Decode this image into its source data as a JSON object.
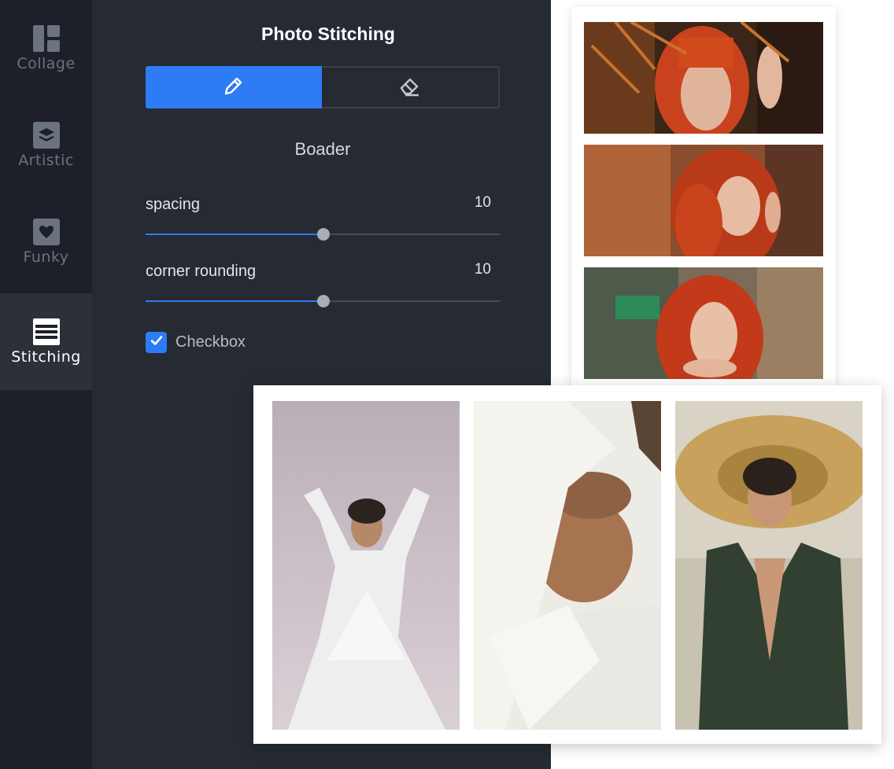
{
  "sidebar": {
    "items": [
      {
        "label": "Collage",
        "icon": "collage-icon",
        "active": false
      },
      {
        "label": "Artistic",
        "icon": "artistic-icon",
        "active": false
      },
      {
        "label": "Funky",
        "icon": "heart-icon",
        "active": false
      },
      {
        "label": "Stitching",
        "icon": "stitching-icon",
        "active": true
      }
    ]
  },
  "panel": {
    "title": "Photo Stitching",
    "segments": [
      {
        "icon": "pencil-icon",
        "active": true
      },
      {
        "icon": "eraser-icon",
        "active": false
      }
    ],
    "section_title": "Boader",
    "sliders": [
      {
        "label": "spacing",
        "value": "10",
        "fill_fraction": 0.5
      },
      {
        "label": "corner rounding",
        "value": "10",
        "fill_fraction": 0.5
      }
    ],
    "checkbox": {
      "label": "Checkbox",
      "checked": true
    }
  },
  "colors": {
    "accent": "#2d7cf6",
    "sidebar_bg": "#1d2029",
    "panel_bg": "#262a33",
    "active_item_bg": "#2c3039"
  }
}
